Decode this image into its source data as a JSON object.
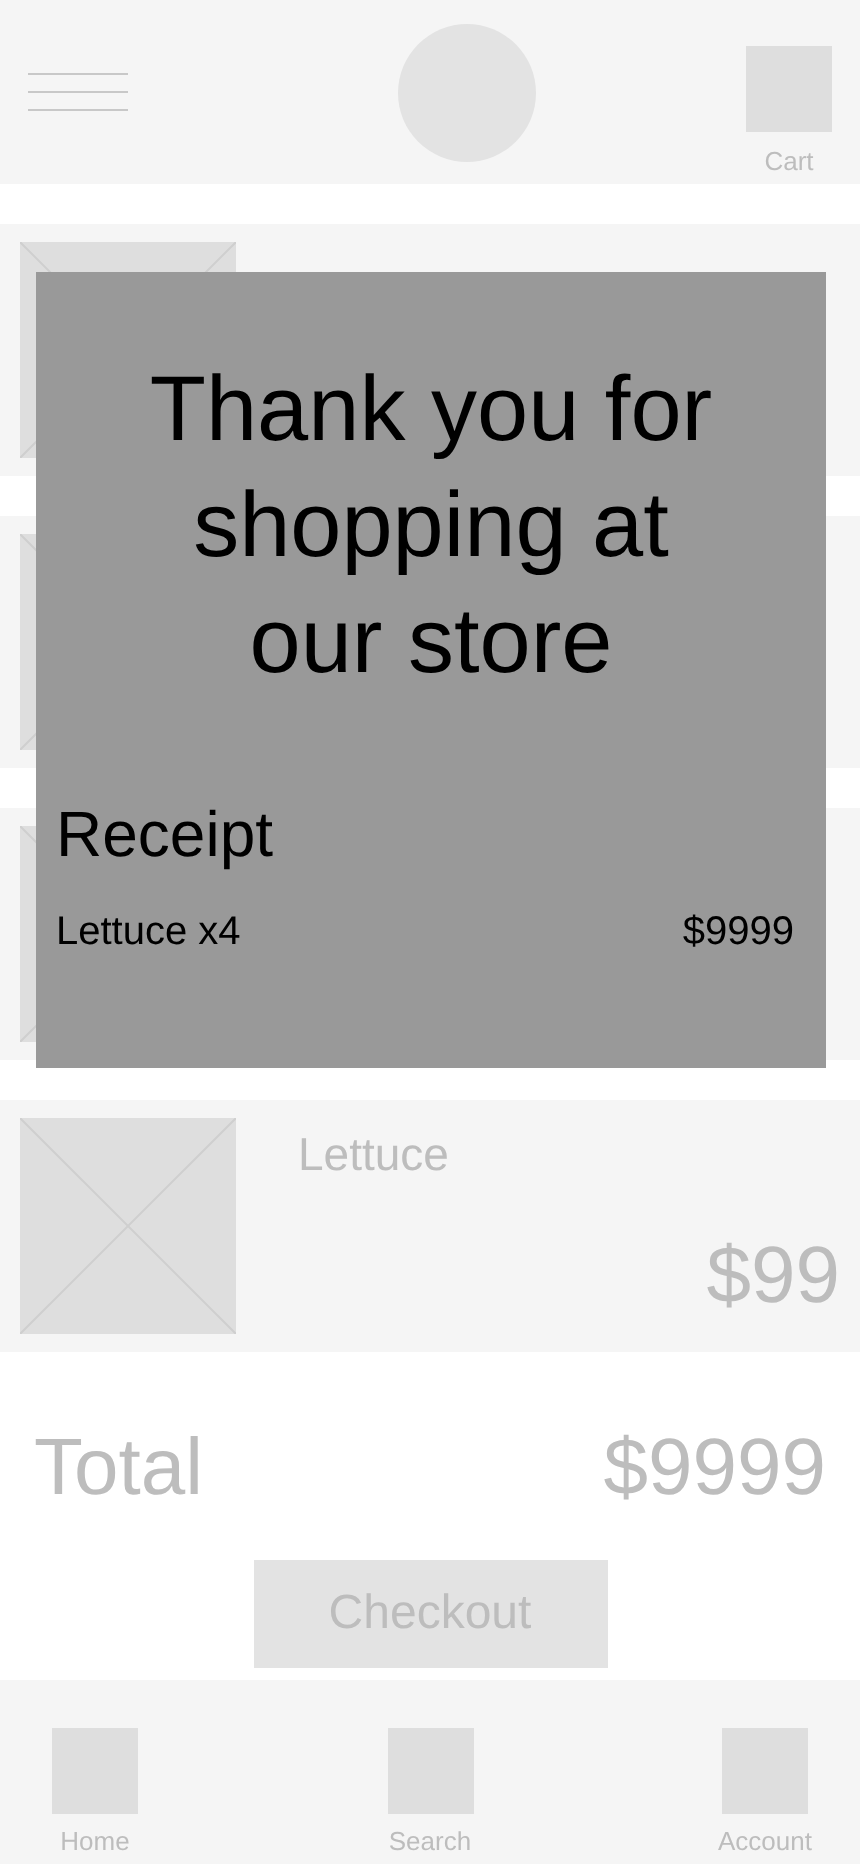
{
  "header": {
    "cart_label": "Cart"
  },
  "cart_items": [
    {
      "kind": "covered"
    },
    {
      "kind": "covered"
    },
    {
      "kind": "covered"
    },
    {
      "kind": "product",
      "name": "Lettuce",
      "price": "$99"
    }
  ],
  "total": {
    "label": "Total",
    "amount": "$9999"
  },
  "checkout_button": "Checkout",
  "bottom_nav": [
    {
      "label": "Home"
    },
    {
      "label": "Search"
    },
    {
      "label": "Account"
    }
  ],
  "modal": {
    "title": "Thank you for shopping at our store",
    "receipt_heading": "Receipt",
    "lines": [
      {
        "item": "Lettuce x4",
        "amount": "$9999"
      }
    ]
  }
}
